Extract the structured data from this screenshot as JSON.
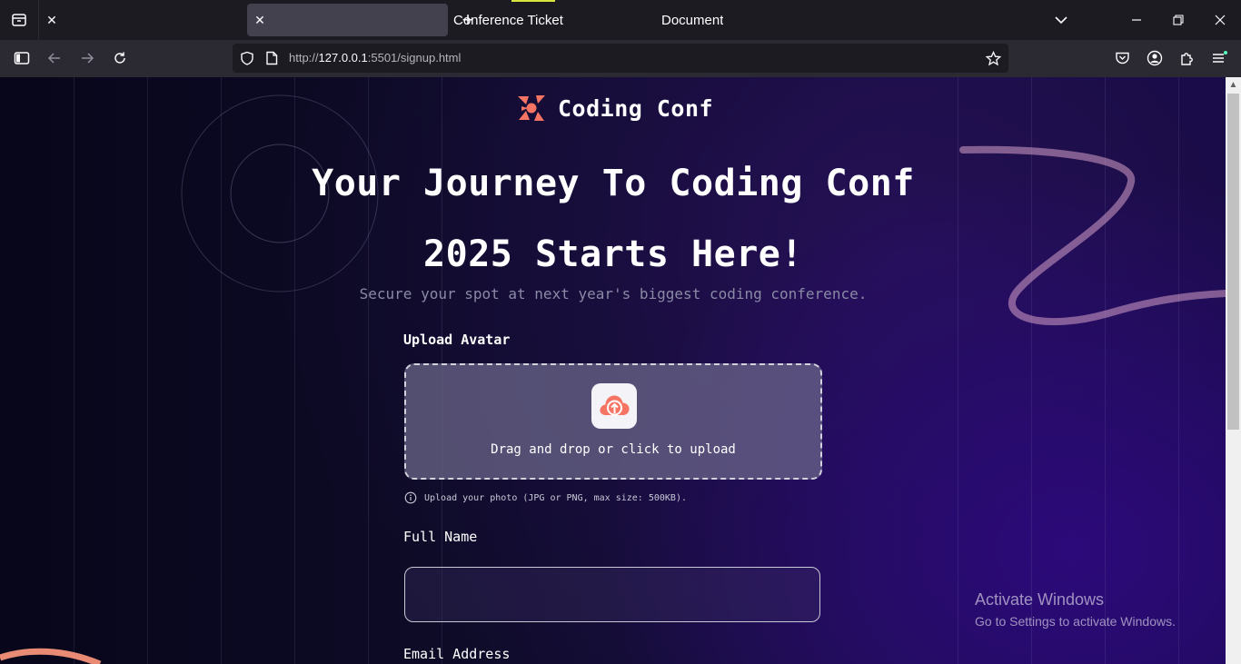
{
  "browser": {
    "tabs": [
      {
        "title": "Conference Ticket",
        "active": false
      },
      {
        "title": "Document",
        "active": true
      }
    ],
    "url_prefix": "http://",
    "url_host": "127.0.0.1",
    "url_rest": ":5501/signup.html"
  },
  "page": {
    "logo_text": "Coding Conf",
    "headline_line1": "Your Journey To Coding Conf",
    "headline_line2": "2025 Starts Here!",
    "subtitle": "Secure your spot at next year's biggest coding conference.",
    "upload_label": "Upload Avatar",
    "dropzone_text": "Drag and drop or click to upload",
    "upload_hint": "Upload your photo (JPG or PNG, max size: 500KB).",
    "full_name_label": "Full Name",
    "full_name_value": "",
    "email_label": "Email Address"
  },
  "os": {
    "activate_title": "Activate Windows",
    "activate_subtitle": "Go to Settings to activate Windows."
  },
  "colors": {
    "accent": "#f57463",
    "active_tab": "#42414d",
    "tab_indicator": "#d8e63c"
  }
}
